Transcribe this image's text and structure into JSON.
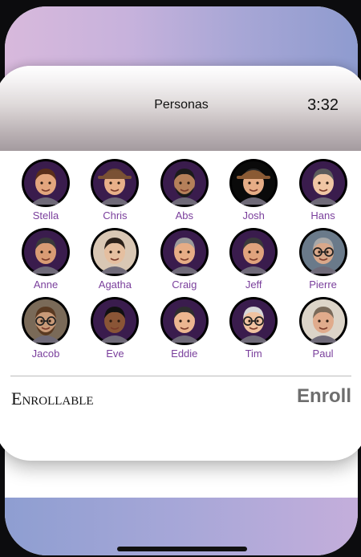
{
  "app": {
    "title": "Personas",
    "time": "3:32"
  },
  "people": [
    {
      "name": "Stella",
      "kind": "memoji",
      "bg": "#3a1c4d",
      "skin": "#e3a67e",
      "hair": "#5a2f1a",
      "hat": "",
      "glasses": false,
      "beard": false
    },
    {
      "name": "Chris",
      "kind": "memoji",
      "bg": "#3a1c4d",
      "skin": "#e8b089",
      "hair": "#6b4a2f",
      "hat": "#7a5134",
      "glasses": false,
      "beard": false
    },
    {
      "name": "Abs",
      "kind": "memoji",
      "bg": "#3a1c4d",
      "skin": "#b5805a",
      "hair": "#1b1b1b",
      "hat": "",
      "glasses": false,
      "beard": true
    },
    {
      "name": "Josh",
      "kind": "memoji",
      "bg": "#0a0a0a",
      "skin": "#e6ad86",
      "hair": "#2a2a2a",
      "hat": "#8a5a34",
      "glasses": false,
      "beard": false
    },
    {
      "name": "Hans",
      "kind": "memoji",
      "bg": "#3a1c4d",
      "skin": "#f0c6a4",
      "hair": "#5c5c5c",
      "hat": "",
      "glasses": false,
      "beard": false
    },
    {
      "name": "Anne",
      "kind": "memoji",
      "bg": "#3a1c4d",
      "skin": "#d99b74",
      "hair": "#3a3a3a",
      "hat": "",
      "glasses": false,
      "beard": false
    },
    {
      "name": "Agatha",
      "kind": "photo",
      "bg": "#d9c7b4",
      "skin": "#e5bfa0",
      "hair": "#2b2019",
      "hat": "",
      "glasses": false,
      "beard": false
    },
    {
      "name": "Craig",
      "kind": "memoji",
      "bg": "#3a1c4d",
      "skin": "#e6ad86",
      "hair": "#9a9a9a",
      "hat": "",
      "glasses": false,
      "beard": false
    },
    {
      "name": "Jeff",
      "kind": "memoji",
      "bg": "#3a1c4d",
      "skin": "#e0a37d",
      "hair": "#3b3b3b",
      "hat": "",
      "glasses": false,
      "beard": false
    },
    {
      "name": "Pierre",
      "kind": "photo",
      "bg": "#6a7a8a",
      "skin": "#d9a88a",
      "hair": "#a8a8a8",
      "hat": "",
      "glasses": true,
      "beard": false
    },
    {
      "name": "Jacob",
      "kind": "photo",
      "bg": "#7a6a58",
      "skin": "#c99a78",
      "hair": "#5a3a22",
      "hat": "",
      "glasses": true,
      "beard": true
    },
    {
      "name": "Eve",
      "kind": "memoji",
      "bg": "#3a1c4d",
      "skin": "#8a5536",
      "hair": "#111111",
      "hat": "",
      "glasses": false,
      "beard": false
    },
    {
      "name": "Eddie",
      "kind": "memoji",
      "bg": "#3a1c4d",
      "skin": "#ecb690",
      "hair": "#2e2e2e",
      "hat": "",
      "glasses": false,
      "beard": false
    },
    {
      "name": "Tim",
      "kind": "memoji",
      "bg": "#3a1c4d",
      "skin": "#f0c2a0",
      "hair": "#d7d7d7",
      "hat": "",
      "glasses": true,
      "beard": false
    },
    {
      "name": "Paul",
      "kind": "photo",
      "bg": "#dcd4c8",
      "skin": "#e0ab8c",
      "hair": "#7a6a5a",
      "hat": "",
      "glasses": false,
      "beard": false
    }
  ],
  "footer": {
    "label": "Enrollable",
    "action": "Enroll"
  },
  "colors": {
    "accent": "#7a3f9c",
    "enroll_disabled": "#6e6e6e",
    "avatar_ring": "#000000",
    "top_gradient": [
      "#d8b9dc",
      "#8e9bcf"
    ],
    "bottom_gradient": [
      "#8e9ed1",
      "#c4aedb"
    ]
  }
}
